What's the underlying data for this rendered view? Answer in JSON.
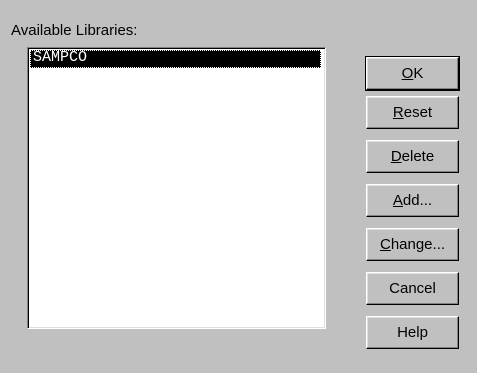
{
  "dialog": {
    "libraries_label": "Available Libraries:",
    "libraries": [
      {
        "name": "SAMPCO",
        "selected": true
      }
    ]
  },
  "buttons": {
    "ok": {
      "mnemonic": "O",
      "rest": "K"
    },
    "reset": {
      "mnemonic": "R",
      "rest": "eset"
    },
    "delete": {
      "mnemonic": "D",
      "rest": "elete"
    },
    "add": {
      "mnemonic": "A",
      "rest": "dd..."
    },
    "change": {
      "mnemonic": "C",
      "rest": "hange..."
    },
    "cancel": {
      "label": "Cancel"
    },
    "help": {
      "label": "Help"
    }
  },
  "colors": {
    "face": "#c0c0c0",
    "selection": "#000000",
    "selection_text": "#ffffff"
  }
}
